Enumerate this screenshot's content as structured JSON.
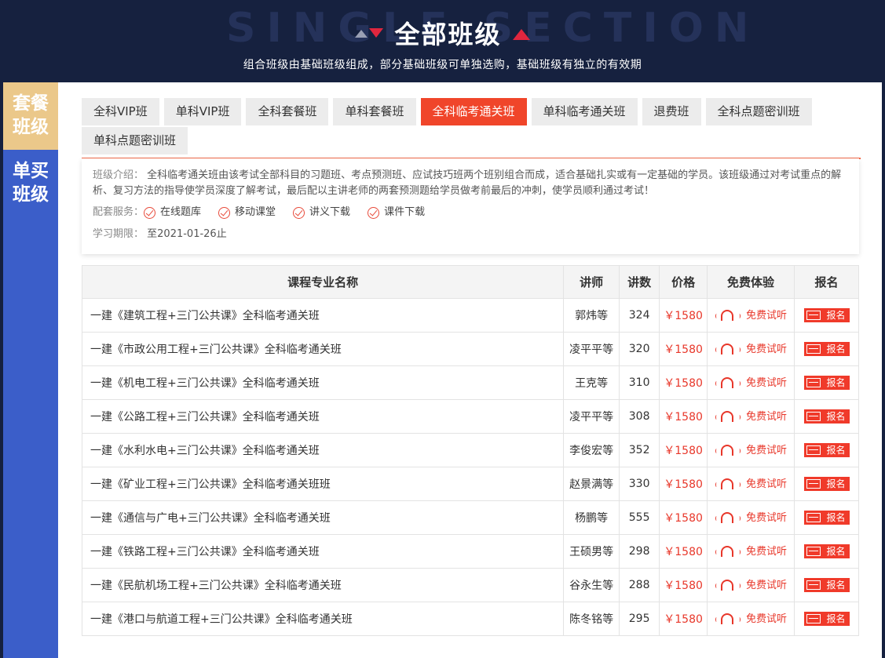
{
  "header": {
    "bg_word": "SINGLE  SECTION",
    "title": "全部班级",
    "subtitle": "组合班级由基础班级组成，部分基础班级可单独选购，基础班级有独立的有效期"
  },
  "side": {
    "items": [
      {
        "label": "套餐班级",
        "active": true
      },
      {
        "label": "单买班级",
        "active": false
      }
    ]
  },
  "tabs": [
    {
      "label": "全科VIP班"
    },
    {
      "label": "单科VIP班"
    },
    {
      "label": "全科套餐班"
    },
    {
      "label": "单科套餐班"
    },
    {
      "label": "全科临考通关班",
      "active": true
    },
    {
      "label": "单科临考通关班"
    },
    {
      "label": "退费班"
    },
    {
      "label": "全科点题密训班"
    },
    {
      "label": "单科点题密训班"
    }
  ],
  "info": {
    "intro_label": "班级介绍：",
    "intro_text": "全科临考通关班由该考试全部科目的习题班、考点预测班、应试技巧班两个班别组合而成，适合基础扎实或有一定基础的学员。该班级通过对考试重点的解析、复习方法的指导使学员深度了解考试，最后配以主讲老师的两套预测题给学员做考前最后的冲刺，使学员顺利通过考试！",
    "services_label": "配套服务：",
    "services": [
      "在线题库",
      "移动课堂",
      "讲义下载",
      "课件下载"
    ],
    "period_label": "学习期限：",
    "period_value": "至2021-01-26止"
  },
  "table": {
    "headers": [
      "课程专业名称",
      "讲师",
      "讲数",
      "价格",
      "免费体验",
      "报名"
    ],
    "trial_label": "免费试听",
    "signup_label": "报名",
    "rows": [
      {
        "name": "一建《建筑工程+三门公共课》全科临考通关班",
        "teacher": "郭炜等",
        "count": "324",
        "price": "￥1580"
      },
      {
        "name": "一建《市政公用工程+三门公共课》全科临考通关班",
        "teacher": "凌平平等",
        "count": "320",
        "price": "￥1580"
      },
      {
        "name": "一建《机电工程+三门公共课》全科临考通关班",
        "teacher": "王克等",
        "count": "310",
        "price": "￥1580"
      },
      {
        "name": "一建《公路工程+三门公共课》全科临考通关班",
        "teacher": "凌平平等",
        "count": "308",
        "price": "￥1580"
      },
      {
        "name": "一建《水利水电+三门公共课》全科临考通关班",
        "teacher": "李俊宏等",
        "count": "352",
        "price": "￥1580"
      },
      {
        "name": "一建《矿业工程+三门公共课》全科临考通关班班",
        "teacher": "赵景满等",
        "count": "330",
        "price": "￥1580"
      },
      {
        "name": "一建《通信与广电+三门公共课》全科临考通关班",
        "teacher": "杨鹏等",
        "count": "555",
        "price": "￥1580"
      },
      {
        "name": "一建《铁路工程+三门公共课》全科临考通关班",
        "teacher": "王硕男等",
        "count": "298",
        "price": "￥1580"
      },
      {
        "name": "一建《民航机场工程+三门公共课》全科临考通关班",
        "teacher": "谷永生等",
        "count": "288",
        "price": "￥1580"
      },
      {
        "name": "一建《港口与航道工程+三门公共课》全科临考通关班",
        "teacher": "陈冬铭等",
        "count": "295",
        "price": "￥1580"
      }
    ]
  },
  "colors": {
    "header_bg": "#16213f",
    "accent_red": "#f0452a",
    "side_blue": "#3b5ec9",
    "side_gold": "#ebc88a"
  }
}
